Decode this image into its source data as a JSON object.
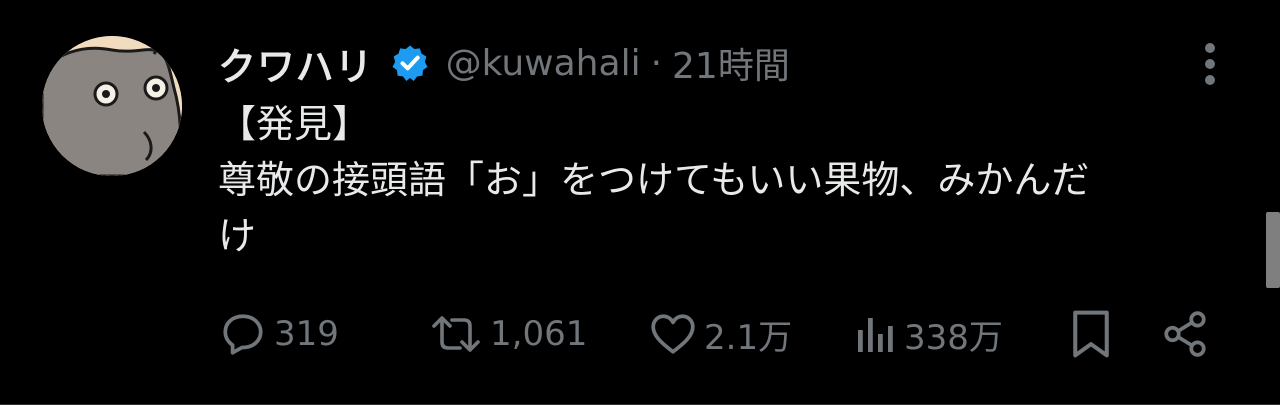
{
  "tweet": {
    "display_name": "クワハリ",
    "verified": true,
    "handle": "@kuwahali",
    "separator": "·",
    "time": "21時間",
    "lines": [
      "【発見】",
      "尊敬の接頭語「お」をつけてもいい果物、みかんだ",
      "け"
    ]
  },
  "actions": {
    "reply": {
      "icon": "reply-icon",
      "count": "319"
    },
    "retweet": {
      "icon": "retweet-icon",
      "count": "1,061"
    },
    "like": {
      "icon": "heart-icon",
      "count": "2.1万"
    },
    "views": {
      "icon": "views-icon",
      "count": "338万"
    },
    "bookmark": {
      "icon": "bookmark-icon"
    },
    "share": {
      "icon": "share-icon"
    }
  },
  "colors": {
    "background": "#000000",
    "text": "#e7e9ea",
    "muted": "#71767b",
    "verified": "#1d9bf0"
  }
}
